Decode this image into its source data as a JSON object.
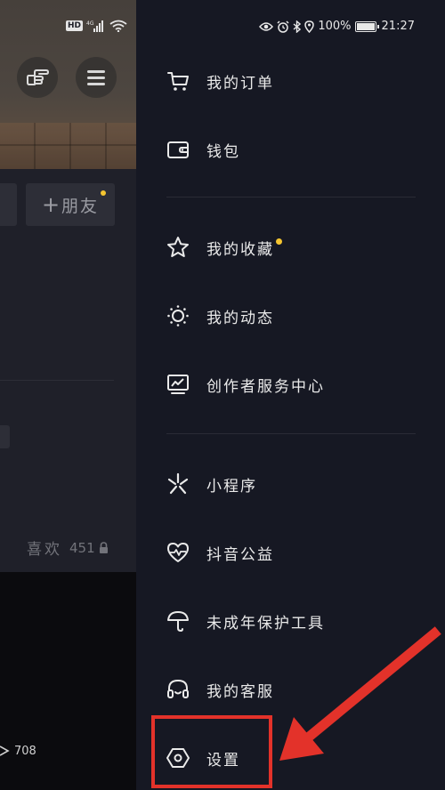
{
  "status_bar": {
    "left": {
      "hd_badge": "HD",
      "network": "4G"
    },
    "right": {
      "battery_percent": "100%",
      "time": "21:27"
    }
  },
  "profile_page": {
    "add_friend_label": "朋友",
    "likes_tab": {
      "label": "喜欢",
      "count": "451"
    },
    "video_view_count": "708"
  },
  "drawer": {
    "section_1": [
      {
        "label": "我的订单",
        "icon": "cart-icon"
      },
      {
        "label": "钱包",
        "icon": "wallet-icon"
      }
    ],
    "section_2": [
      {
        "label": "我的收藏",
        "icon": "star-icon",
        "has_dot": true
      },
      {
        "label": "我的动态",
        "icon": "sun-icon"
      },
      {
        "label": "创作者服务中心",
        "icon": "monitor-chart-icon"
      }
    ],
    "section_3": [
      {
        "label": "小程序",
        "icon": "mini-program-icon"
      },
      {
        "label": "抖音公益",
        "icon": "heart-pulse-icon"
      },
      {
        "label": "未成年保护工具",
        "icon": "umbrella-icon"
      },
      {
        "label": "我的客服",
        "icon": "headset-icon"
      },
      {
        "label": "设置",
        "icon": "settings-hexagon-icon"
      }
    ]
  },
  "annotation": {
    "highlight_color": "#e3322a",
    "dot_color": "#f5c530"
  }
}
